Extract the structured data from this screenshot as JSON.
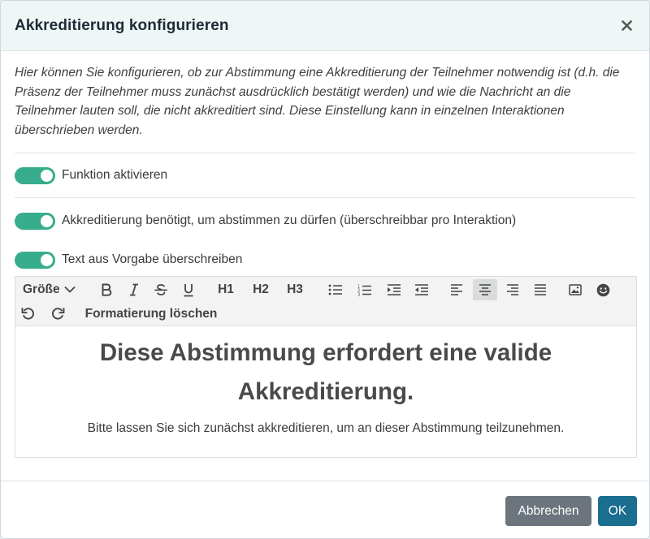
{
  "modal": {
    "title": "Akkreditierung konfigurieren",
    "intro": "Hier können Sie konfigurieren, ob zur Abstimmung eine Akkreditierung der Teilnehmer notwendig ist (d.h. die Präsenz der Teilnehmer muss zunächst ausdrücklich bestätigt werden) und wie die Nachricht an die Teilnehmer lauten soll, die nicht akkreditiert sind. Diese Einstellung kann in einzelnen Interaktionen überschrieben werden.",
    "accent_color": "#38ad8e"
  },
  "toggles": [
    {
      "label": "Funktion aktivieren",
      "on": true
    },
    {
      "label": "Akkreditierung benötigt, um abstimmen zu dürfen (überschreibbar pro Interaktion)",
      "on": true
    },
    {
      "label": "Text aus Vorgabe überschreiben",
      "on": true
    }
  ],
  "toolbar": {
    "size_label": "Größe",
    "h1": "H1",
    "h2": "H2",
    "h3": "H3",
    "clear_format": "Formatierung löschen",
    "active_align": "center"
  },
  "editor": {
    "heading": "Diese Abstimmung erfordert eine valide Akkreditierung.",
    "paragraph": "Bitte lassen Sie sich zunächst akkreditieren, um an dieser Abstimmung teilzunehmen."
  },
  "footer": {
    "cancel_label": "Abbrechen",
    "ok_label": "OK",
    "cancel_color": "#6c757d",
    "ok_color": "#1a6e8f"
  }
}
